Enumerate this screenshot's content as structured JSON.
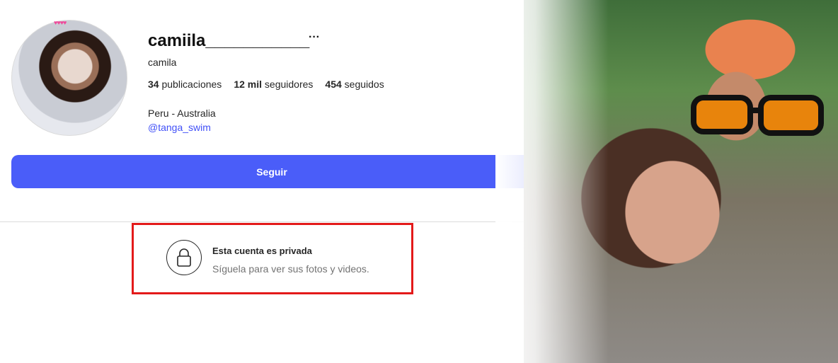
{
  "profile": {
    "username": "camiila___________",
    "more_icon": "···",
    "full_name": "camila",
    "stats": {
      "posts_count": "34",
      "posts_label": "publicaciones",
      "followers_count": "12 mil",
      "followers_label": "seguidores",
      "following_count": "454",
      "following_label": "seguidos"
    },
    "bio_location": "Peru - Australia",
    "bio_link": "@tanga_swim",
    "avatar_badge": "♥♥♥♥"
  },
  "actions": {
    "follow_label": "Seguir"
  },
  "private_notice": {
    "title": "Esta cuenta es privada",
    "subtitle": "Síguela para ver sus fotos y videos.",
    "icon": "lock-icon"
  },
  "colors": {
    "follow_button": "#4a5df9",
    "link": "#4150f7",
    "highlight_box": "#e31a1a"
  }
}
